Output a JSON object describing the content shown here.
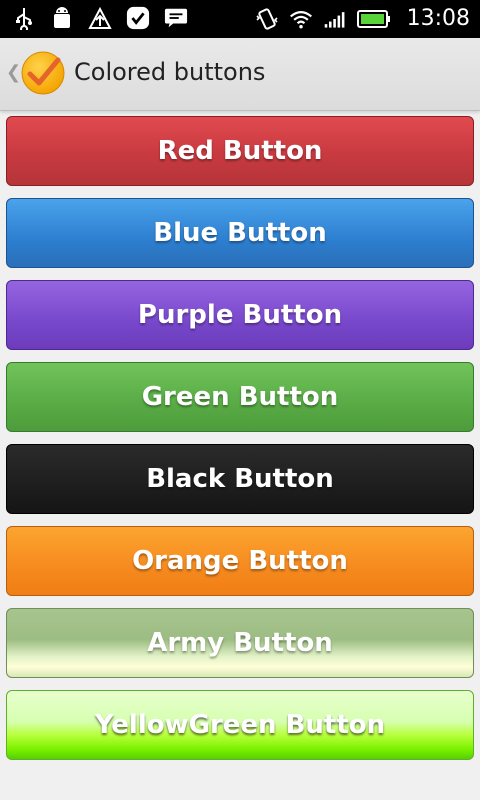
{
  "status_bar": {
    "time": "13:08",
    "icons": [
      "usb-icon",
      "android-debug-icon",
      "upload-icon",
      "task-check-icon",
      "message-icon",
      "vibrate-icon",
      "wifi-icon",
      "signal-icon",
      "battery-icon"
    ]
  },
  "action_bar": {
    "title": "Colored buttons",
    "back_icon": "chevron-left-icon",
    "app_icon": "check-icon"
  },
  "buttons": [
    {
      "label": "Red Button",
      "color": "#d23f44"
    },
    {
      "label": "Blue Button",
      "color": "#2d7fd0"
    },
    {
      "label": "Purple Button",
      "color": "#7848cc"
    },
    {
      "label": "Green Button",
      "color": "#58ab45"
    },
    {
      "label": "Black Button",
      "color": "#151515"
    },
    {
      "label": "Orange Button",
      "color": "#f68a1f"
    },
    {
      "label": "Army Button",
      "color": "#9cbd83"
    },
    {
      "label": "YellowGreen Button",
      "color": "#7df200"
    }
  ]
}
